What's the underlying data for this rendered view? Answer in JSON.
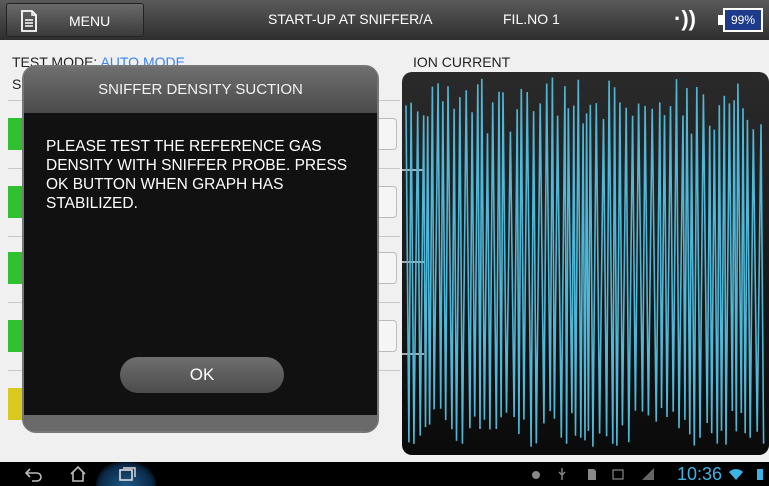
{
  "topbar": {
    "menu_label": "MENU",
    "title": "START-UP AT SNIFFER/A",
    "fil_no": "FIL.NO 1",
    "signal_symbol": "·))",
    "battery": "99%"
  },
  "panel": {
    "test_mode_label": "TEST MODE:",
    "test_mode_value": "AUTO MODE",
    "s_label": "S",
    "ion_current_label": "ION CURRENT"
  },
  "dialog": {
    "title": "SNIFFER DENSITY SUCTION",
    "message": "PLEASE TEST THE REFERENCE GAS\nDENSITY WITH SNIFFER PROBE. PRESS\nOK BUTTON WHEN GRAPH HAS\nSTABILIZED.",
    "ok_label": "OK"
  },
  "statusbar": {
    "time": "10:36"
  },
  "colors": {
    "accent_blue": "#3b82f6",
    "graph_line": "#4fb8d8",
    "green_bar": "#2fc02f",
    "yellow_bar": "#d8c820",
    "clock": "#3ab4e6"
  },
  "graph": {
    "y_ticks": 3,
    "signal": "oscillating"
  }
}
